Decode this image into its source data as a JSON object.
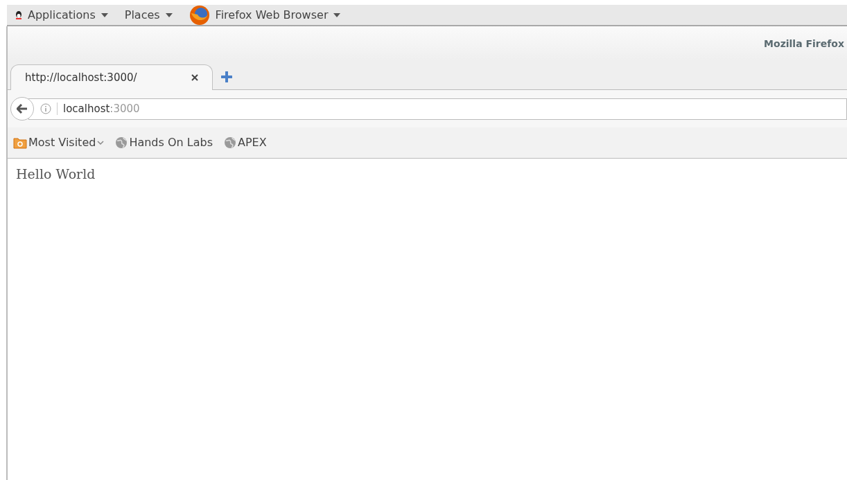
{
  "top_panel": {
    "menus": [
      {
        "label": "Applications",
        "kind": "apps"
      },
      {
        "label": "Places",
        "kind": "plain"
      },
      {
        "label": "Firefox Web Browser",
        "kind": "app"
      }
    ]
  },
  "window": {
    "title": "Mozilla Firefox"
  },
  "tabs": [
    {
      "label": "http://localhost:3000/",
      "selected": true
    }
  ],
  "address_bar": {
    "host": "localhost",
    "port": ":3000"
  },
  "bookmarks": [
    {
      "label": "Most Visited",
      "kind": "folder"
    },
    {
      "label": "Hands On Labs",
      "kind": "site"
    },
    {
      "label": "APEX",
      "kind": "site"
    }
  ],
  "page": {
    "text": "Hello World"
  }
}
